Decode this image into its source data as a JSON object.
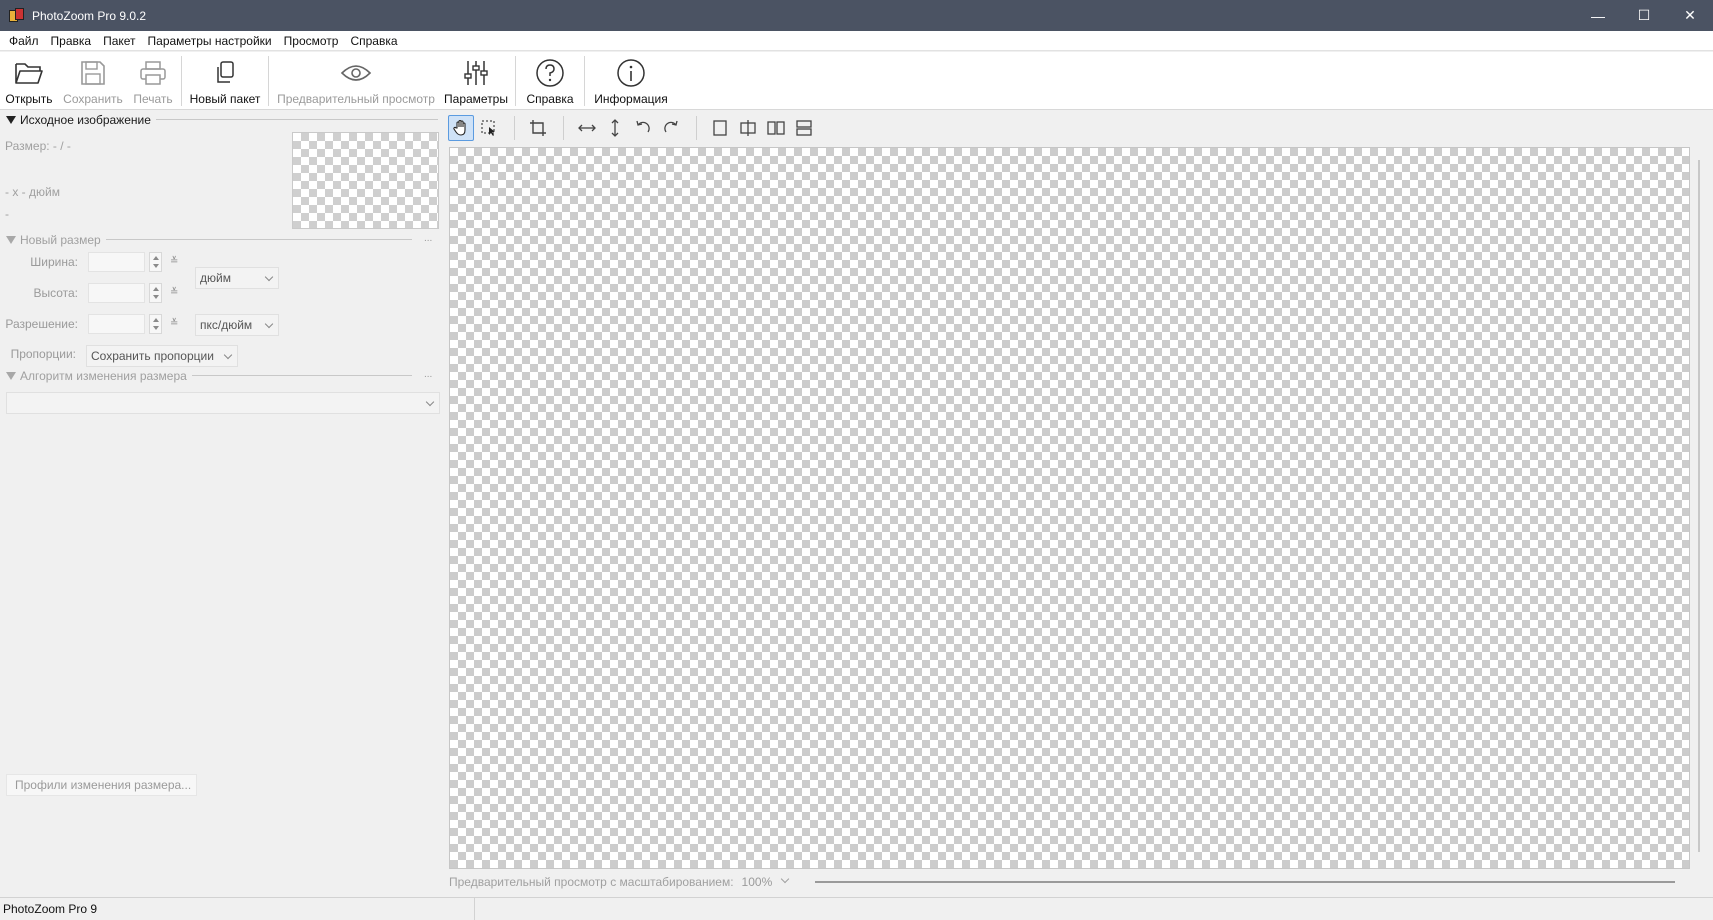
{
  "window": {
    "title": "PhotoZoom Pro 9.0.2",
    "controls": {
      "minimize": "—",
      "maximize": "☐",
      "close": "✕"
    }
  },
  "menu": [
    "Файл",
    "Правка",
    "Пакет",
    "Параметры настройки",
    "Просмотр",
    "Справка"
  ],
  "toolbar": {
    "open": "Открыть",
    "save": "Сохранить",
    "print": "Печать",
    "new_batch": "Новый пакет",
    "preview": "Предварительный просмотр",
    "settings": "Параметры",
    "help": "Справка",
    "info": "Информация"
  },
  "source_image": {
    "header": "Исходное изображение",
    "size_line": "Размер: - / -",
    "dims_line": "- x - дюйм",
    "extra_line": "-"
  },
  "new_size": {
    "header": "Новый размер",
    "width_label": "Ширина:",
    "height_label": "Высота:",
    "resolution_label": "Разрешение:",
    "unit": "дюйм",
    "res_unit": "пкс/дюйм",
    "proportions_label": "Пропорции:",
    "proportions_value": "Сохранить пропорции",
    "more": "..."
  },
  "algorithm": {
    "header": "Алгоритм изменения размера",
    "more": "...",
    "value": ""
  },
  "profiles_button": "Профили изменения размера...",
  "zoom": {
    "label": "Предварительный просмотр с масштабированием:",
    "value": "100%"
  },
  "status": {
    "text": "PhotoZoom Pro 9"
  },
  "icons": {
    "view_tools": [
      "hand-icon",
      "select-icon",
      "crop-icon",
      "fit-width-icon",
      "fit-height-icon",
      "rotate-left-icon",
      "rotate-right-icon",
      "single-view-icon",
      "split-view-icon",
      "side-by-side-icon",
      "stacked-view-icon"
    ]
  },
  "colors": {
    "titlebar": "#4b5363",
    "active_tool": "#cfe2f7",
    "active_border": "#5b9be0"
  }
}
